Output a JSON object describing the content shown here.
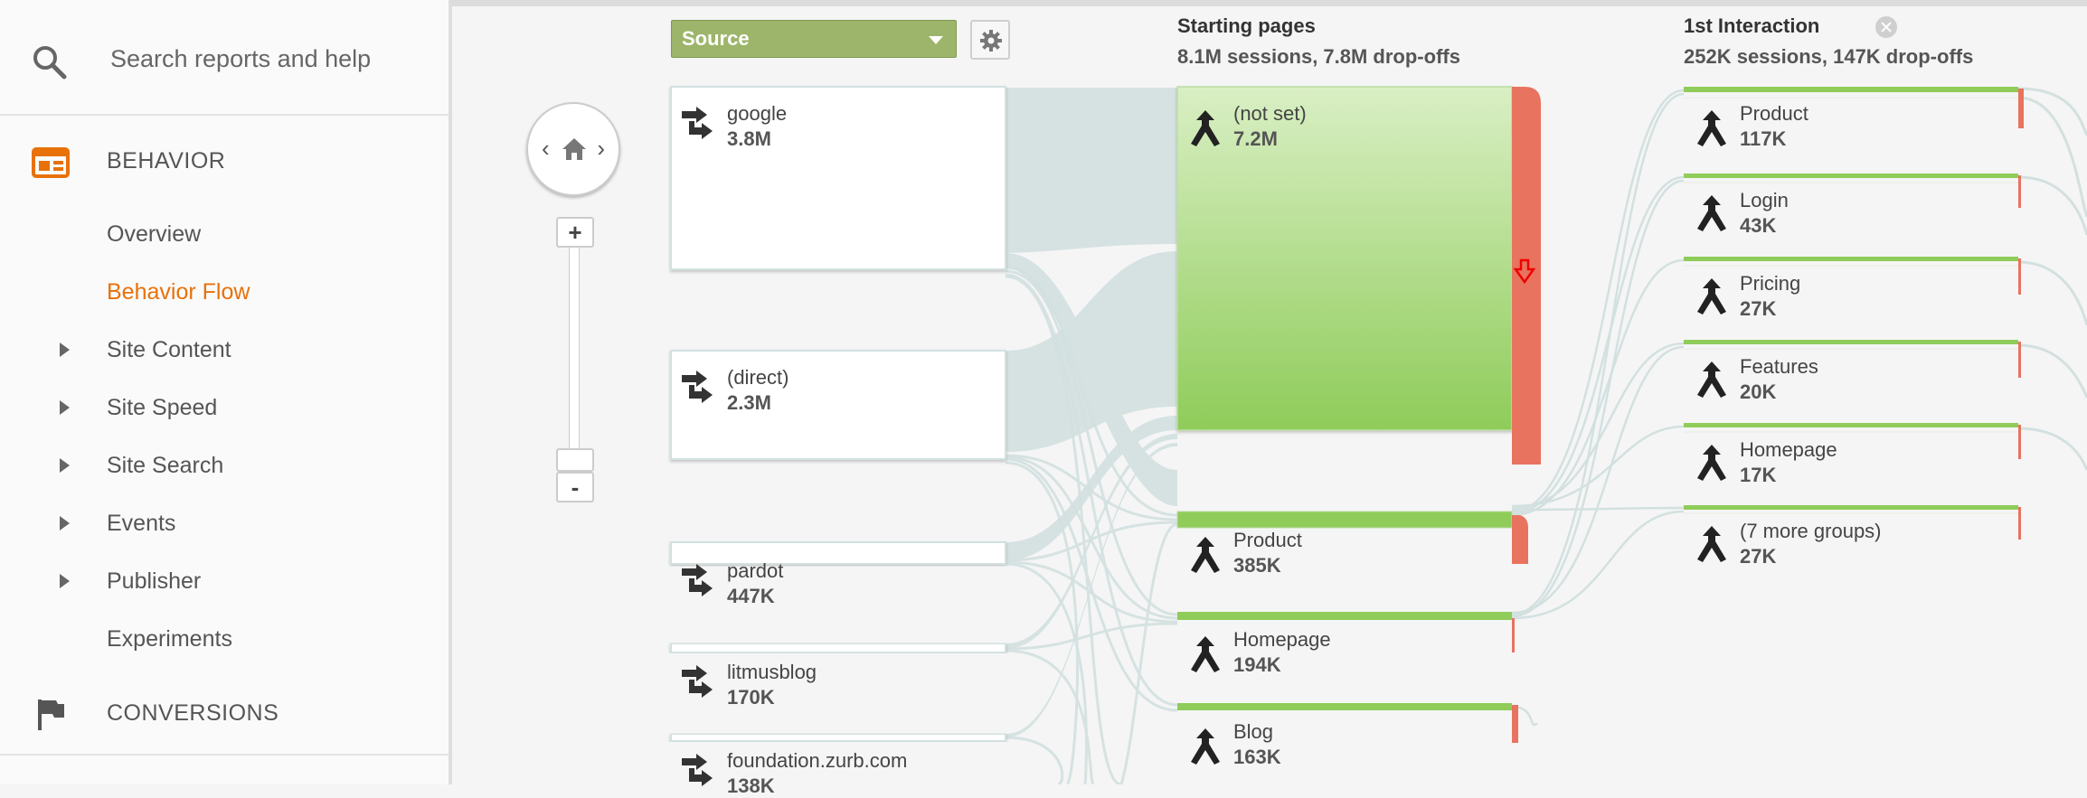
{
  "sidebar": {
    "search_placeholder": "Search reports and help",
    "behavior_label": "BEHAVIOR",
    "items": [
      {
        "label": "Overview",
        "arrow": false,
        "active": false
      },
      {
        "label": "Behavior Flow",
        "arrow": false,
        "active": true
      },
      {
        "label": "Site Content",
        "arrow": true,
        "active": false
      },
      {
        "label": "Site Speed",
        "arrow": true,
        "active": false
      },
      {
        "label": "Site Search",
        "arrow": true,
        "active": false
      },
      {
        "label": "Events",
        "arrow": true,
        "active": false
      },
      {
        "label": "Publisher",
        "arrow": true,
        "active": false
      },
      {
        "label": "Experiments",
        "arrow": false,
        "active": false
      }
    ],
    "conversions_label": "CONVERSIONS"
  },
  "toolbar": {
    "dimension_select": "Source"
  },
  "columns": {
    "starting": {
      "title": "Starting pages",
      "summary": "8.1M sessions, 7.8M drop-offs"
    },
    "first": {
      "title": "1st Interaction",
      "summary": "252K sessions, 147K drop-offs"
    }
  },
  "sources": [
    {
      "name": "google",
      "value": "3.8M"
    },
    {
      "name": "(direct)",
      "value": "2.3M"
    },
    {
      "name": "pardot",
      "value": "447K"
    },
    {
      "name": "litmusblog",
      "value": "170K"
    },
    {
      "name": "foundation.zurb.com",
      "value": "138K"
    }
  ],
  "starting_pages": [
    {
      "name": "(not set)",
      "value": "7.2M"
    },
    {
      "name": "Product",
      "value": "385K"
    },
    {
      "name": "Homepage",
      "value": "194K"
    },
    {
      "name": "Blog",
      "value": "163K"
    }
  ],
  "first_interaction": [
    {
      "name": "Product",
      "value": "117K"
    },
    {
      "name": "Login",
      "value": "43K"
    },
    {
      "name": "Pricing",
      "value": "27K"
    },
    {
      "name": "Features",
      "value": "20K"
    },
    {
      "name": "Homepage",
      "value": "17K"
    },
    {
      "name": "(7 more groups)",
      "value": "27K"
    }
  ],
  "colors": {
    "accent": "#e8710a",
    "node_green": "#8fcc5a",
    "dropoff_red": "#e8735f",
    "flow": "#d3e0e0",
    "select_green": "#9db56a"
  }
}
